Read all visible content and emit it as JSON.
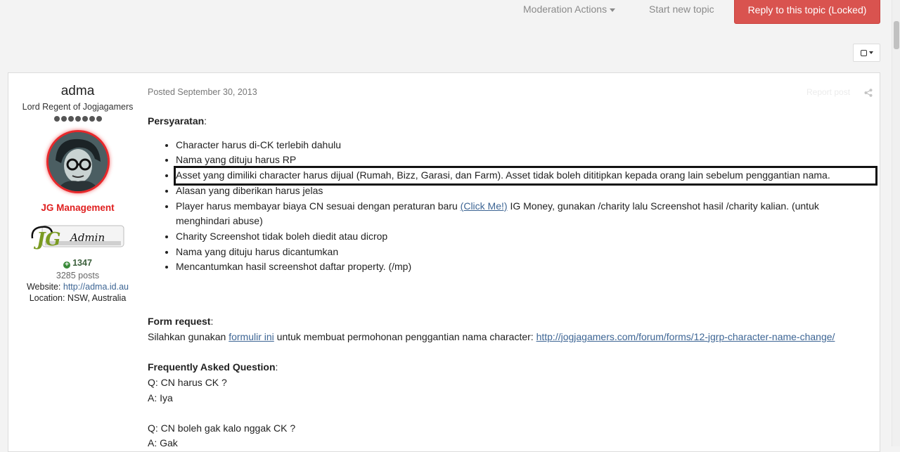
{
  "toolbar": {
    "moderation_actions": "Moderation Actions",
    "start_new_topic": "Start new topic",
    "reply_locked": "Reply to this topic (Locked)"
  },
  "author": {
    "name": "adma",
    "title": "Lord Regent of Jogjagamers",
    "group": "JG Management",
    "badge_text": "JG Admin",
    "reputation": "1347",
    "posts": "3285 posts",
    "website_label": "Website:",
    "website": "http://adma.id.au",
    "location_label": "Location:",
    "location": "NSW, Australia"
  },
  "post": {
    "posted": "Posted September 30, 2013",
    "report": "Report post",
    "requirements_heading": "Persyaratan",
    "requirements": [
      "Character harus di-CK terlebih dahulu",
      "Nama yang dituju harus RP",
      "Asset yang dimiliki character harus dijual (Rumah, Bizz, Garasi, dan Farm). Asset tidak boleh dititipkan kepada orang lain sebelum penggantian nama.",
      "Alasan yang diberikan harus jelas",
      "Charity Screenshot tidak boleh diedit atau dicrop",
      "Nama yang dituju harus dicantumkan",
      "Mencantumkan hasil screenshot daftar property. (/mp)"
    ],
    "cn_item_pre": "Player harus membayar biaya CN sesuai dengan peraturan baru ",
    "cn_item_link": "(Click Me!)",
    "cn_item_post": " IG Money, gunakan /charity lalu Screenshot hasil /charity kalian. (untuk menghindari abuse)",
    "form_heading": "Form request",
    "form_pre": "Silahkan gunakan ",
    "form_link": "formulir ini",
    "form_mid": " untuk membuat permohonan penggantian nama character: ",
    "form_url": "http://jogjagamers.com/forum/forms/12-jgrp-character-name-change/",
    "faq_heading": "Frequently Asked Question",
    "faq": [
      {
        "q": "Q: CN harus CK ?",
        "a": "A: Iya"
      },
      {
        "q": "Q: CN boleh gak kalo nggak CK ?",
        "a": "A: Gak"
      }
    ]
  },
  "colors": {
    "reply_button": "#d9534f",
    "group_name": "#e02020",
    "link": "#3d6594"
  }
}
